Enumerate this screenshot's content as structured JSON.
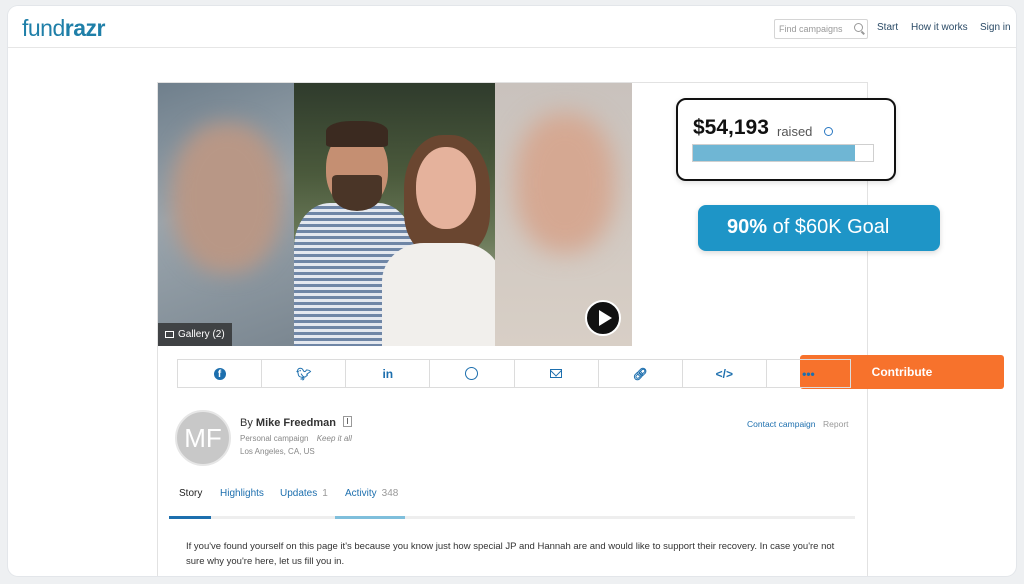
{
  "header": {
    "logo_part1": "fund",
    "logo_part2": "razr",
    "search_placeholder": "Find campaigns",
    "nav": [
      "Start",
      "How it works",
      "Sign in"
    ]
  },
  "media": {
    "gallery_label": "Gallery (2)"
  },
  "funding": {
    "amount": "$54,193",
    "raised_label": "raised",
    "progress_fraction": 0.9,
    "goal_percent": "90%",
    "goal_text": "of $60K Goal",
    "contribute_label": "Contribute"
  },
  "share_icons": [
    "facebook-icon",
    "twitter-icon",
    "linkedin-icon",
    "messenger-icon",
    "email-icon",
    "link-icon",
    "embed-icon",
    "more-icon"
  ],
  "organizer": {
    "initials": "MF",
    "by_prefix": "By",
    "name": "Mike Freedman",
    "campaign_type": "Personal campaign",
    "keep_it_all": "Keep it all",
    "location": "Los Angeles, CA, US",
    "contact_label": "Contact campaign",
    "report_label": "Report"
  },
  "tabs": [
    {
      "label": "Story",
      "count": ""
    },
    {
      "label": "Highlights",
      "count": ""
    },
    {
      "label": "Updates",
      "count": "1"
    },
    {
      "label": "Activity",
      "count": "348"
    }
  ],
  "colors": {
    "brand": "#1f7fa8",
    "accent_orange": "#f7722c",
    "goal_blue": "#1e95c7",
    "progress_fill": "#6fb6d4",
    "link": "#1d6fae"
  },
  "story_text": "If you've found yourself on this page it's because you know just how special JP and Hannah are and would like to support their recovery. In case you're not sure why you're here, let us fill you in."
}
